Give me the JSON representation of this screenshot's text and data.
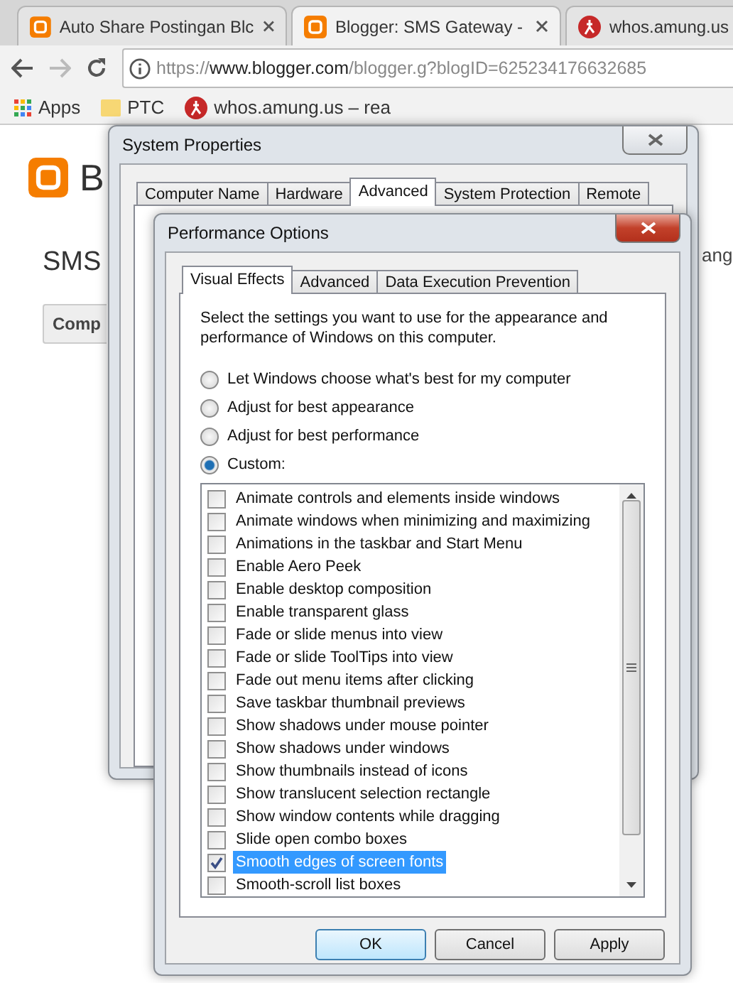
{
  "browser": {
    "tabs": [
      {
        "title": "Auto Share Postingan Blc",
        "selected": false
      },
      {
        "title": "Blogger: SMS Gateway -",
        "selected": true
      },
      {
        "title": "whos.amung.us",
        "selected": false
      }
    ],
    "url": {
      "scheme": "https://",
      "host": "www.blogger.com",
      "path": "/blogger.g?blogID=625234176632685"
    },
    "bookmarks": [
      "Apps",
      "PTC",
      "whos.amung.us – rea"
    ]
  },
  "page": {
    "logo_text": "B",
    "heading": "SMS",
    "button": "Comp",
    "side_text": "ang"
  },
  "system_properties": {
    "title": "System Properties",
    "tabs": [
      {
        "label": "Computer Name",
        "selected": false
      },
      {
        "label": "Hardware",
        "selected": false
      },
      {
        "label": "Advanced",
        "selected": true
      },
      {
        "label": "System Protection",
        "selected": false
      },
      {
        "label": "Remote",
        "selected": false
      }
    ]
  },
  "performance_options": {
    "title": "Performance Options",
    "tabs": [
      {
        "label": "Visual Effects",
        "selected": true
      },
      {
        "label": "Advanced",
        "selected": false
      },
      {
        "label": "Data Execution Prevention",
        "selected": false
      }
    ],
    "description": "Select the settings you want to use for the appearance and performance of Windows on this computer.",
    "options": [
      {
        "label": "Let Windows choose what's best for my computer",
        "selected": false
      },
      {
        "label": "Adjust for best appearance",
        "selected": false
      },
      {
        "label": "Adjust for best performance",
        "selected": false
      },
      {
        "label": "Custom:",
        "selected": true
      }
    ],
    "effects": [
      {
        "label": "Animate controls and elements inside windows",
        "checked": false,
        "selected": false
      },
      {
        "label": "Animate windows when minimizing and maximizing",
        "checked": false,
        "selected": false
      },
      {
        "label": "Animations in the taskbar and Start Menu",
        "checked": false,
        "selected": false
      },
      {
        "label": "Enable Aero Peek",
        "checked": false,
        "selected": false
      },
      {
        "label": "Enable desktop composition",
        "checked": false,
        "selected": false
      },
      {
        "label": "Enable transparent glass",
        "checked": false,
        "selected": false
      },
      {
        "label": "Fade or slide menus into view",
        "checked": false,
        "selected": false
      },
      {
        "label": "Fade or slide ToolTips into view",
        "checked": false,
        "selected": false
      },
      {
        "label": "Fade out menu items after clicking",
        "checked": false,
        "selected": false
      },
      {
        "label": "Save taskbar thumbnail previews",
        "checked": false,
        "selected": false
      },
      {
        "label": "Show shadows under mouse pointer",
        "checked": false,
        "selected": false
      },
      {
        "label": "Show shadows under windows",
        "checked": false,
        "selected": false
      },
      {
        "label": "Show thumbnails instead of icons",
        "checked": false,
        "selected": false
      },
      {
        "label": "Show translucent selection rectangle",
        "checked": false,
        "selected": false
      },
      {
        "label": "Show window contents while dragging",
        "checked": false,
        "selected": false
      },
      {
        "label": "Slide open combo boxes",
        "checked": false,
        "selected": false
      },
      {
        "label": "Smooth edges of screen fonts",
        "checked": true,
        "selected": true
      },
      {
        "label": "Smooth-scroll list boxes",
        "checked": false,
        "selected": false
      }
    ],
    "buttons": [
      "OK",
      "Cancel",
      "Apply"
    ]
  }
}
